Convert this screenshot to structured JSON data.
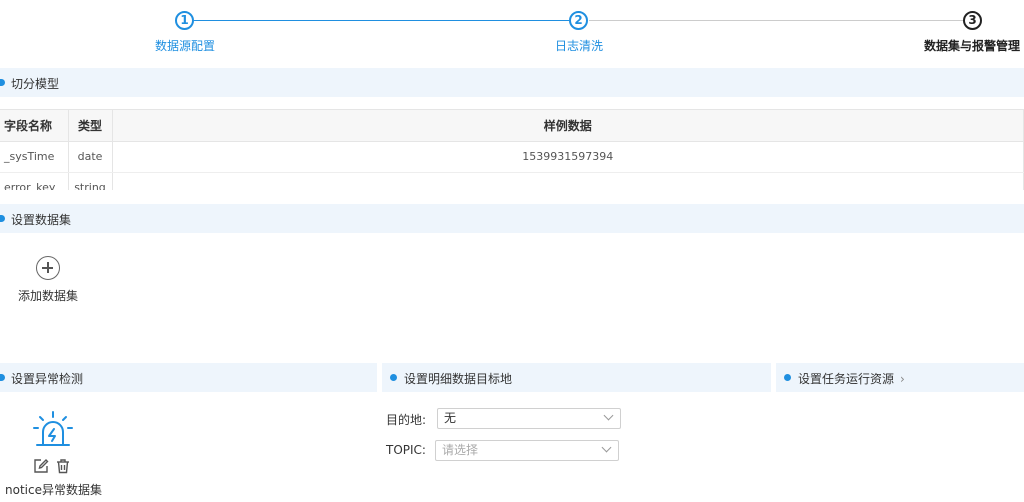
{
  "steps": [
    {
      "num": "1",
      "label": "数据源配置",
      "state": "done"
    },
    {
      "num": "2",
      "label": "日志清洗",
      "state": "done"
    },
    {
      "num": "3",
      "label": "数据集与报警管理",
      "state": "current"
    }
  ],
  "sections": {
    "split_model": "切分模型",
    "dataset": "设置数据集",
    "anomaly": "设置异常检测",
    "detail_target": "设置明细数据目标地",
    "task_resource": "设置任务运行资源"
  },
  "table": {
    "headers": [
      "字段名称",
      "类型",
      "样例数据"
    ],
    "rows": [
      [
        "_sysTime",
        "date",
        "1539931597394"
      ],
      [
        "error_key",
        "string",
        ""
      ]
    ]
  },
  "dataset": {
    "add_label": "添加数据集"
  },
  "anomaly": {
    "item_label": "notice异常数据集"
  },
  "form": {
    "destination_label": "目的地:",
    "destination_value": "无",
    "topic_label": "TOPIC:",
    "topic_placeholder": "请选择"
  },
  "colors": {
    "accent": "#1f8fe0",
    "section_bg": "#eef5fc"
  }
}
